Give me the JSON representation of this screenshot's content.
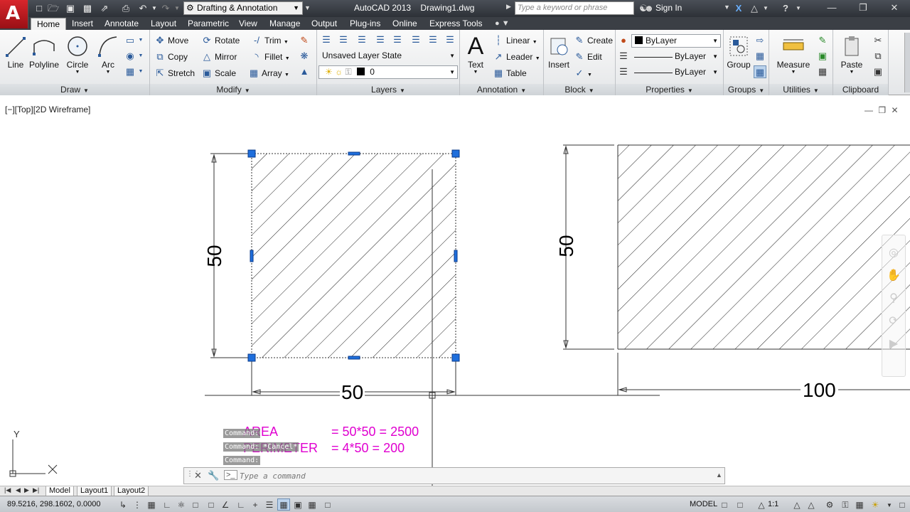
{
  "titlebar": {
    "workspace": "Drafting & Annotation",
    "app_name": "AutoCAD 2013",
    "document": "Drawing1.dwg",
    "search_placeholder": "Type a keyword or phrase",
    "signin": "Sign In"
  },
  "tabs": [
    "Home",
    "Insert",
    "Annotate",
    "Layout",
    "Parametric",
    "View",
    "Manage",
    "Output",
    "Plug-ins",
    "Online",
    "Express Tools"
  ],
  "ribbon": {
    "draw": {
      "title": "Draw",
      "line": "Line",
      "polyline": "Polyline",
      "circle": "Circle",
      "arc": "Arc"
    },
    "modify": {
      "title": "Modify",
      "move": "Move",
      "rotate": "Rotate",
      "trim": "Trim",
      "copy": "Copy",
      "mirror": "Mirror",
      "fillet": "Fillet",
      "stretch": "Stretch",
      "scale": "Scale",
      "array": "Array"
    },
    "layers": {
      "title": "Layers",
      "layer_state": "Unsaved Layer State",
      "current_layer": "0"
    },
    "annotation": {
      "title": "Annotation",
      "text": "Text",
      "linear": "Linear",
      "leader": "Leader",
      "table": "Table"
    },
    "block": {
      "title": "Block",
      "insert": "Insert",
      "create": "Create",
      "edit": "Edit"
    },
    "properties": {
      "title": "Properties",
      "color": "ByLayer",
      "linetype": "ByLayer",
      "lineweight": "ByLayer"
    },
    "groups": {
      "title": "Groups",
      "group": "Group"
    },
    "utilities": {
      "title": "Utilities",
      "measure": "Measure"
    },
    "clipboard": {
      "title": "Clipboard",
      "paste": "Paste"
    }
  },
  "viewport": {
    "label": "[−][Top][2D Wireframe]"
  },
  "drawing": {
    "dim_left_vertical": "50",
    "dim_left_horizontal": "50",
    "dim_right_vertical": "50",
    "dim_right_horizontal": "100",
    "note_area_label": "AREA",
    "note_area_formula": "= 50*50 = 2500",
    "note_perimeter_label": "PERIMETER",
    "note_perimeter_formula": "= 4*50 = 200",
    "ucs_y": "Y",
    "ucs_x": "X"
  },
  "command": {
    "history": [
      "Command:",
      "Command: *Cancel*",
      "Command:"
    ],
    "placeholder": "Type a command"
  },
  "layout_tabs": [
    "Model",
    "Layout1",
    "Layout2"
  ],
  "status": {
    "coords": "89.5216, 298.1602, 0.0000",
    "model": "MODEL",
    "scale": "1:1"
  },
  "colors": {
    "hatch": "#222222",
    "grip": "#1f6fdc",
    "note": "#e000d0",
    "titlebar": "#2d3137"
  }
}
